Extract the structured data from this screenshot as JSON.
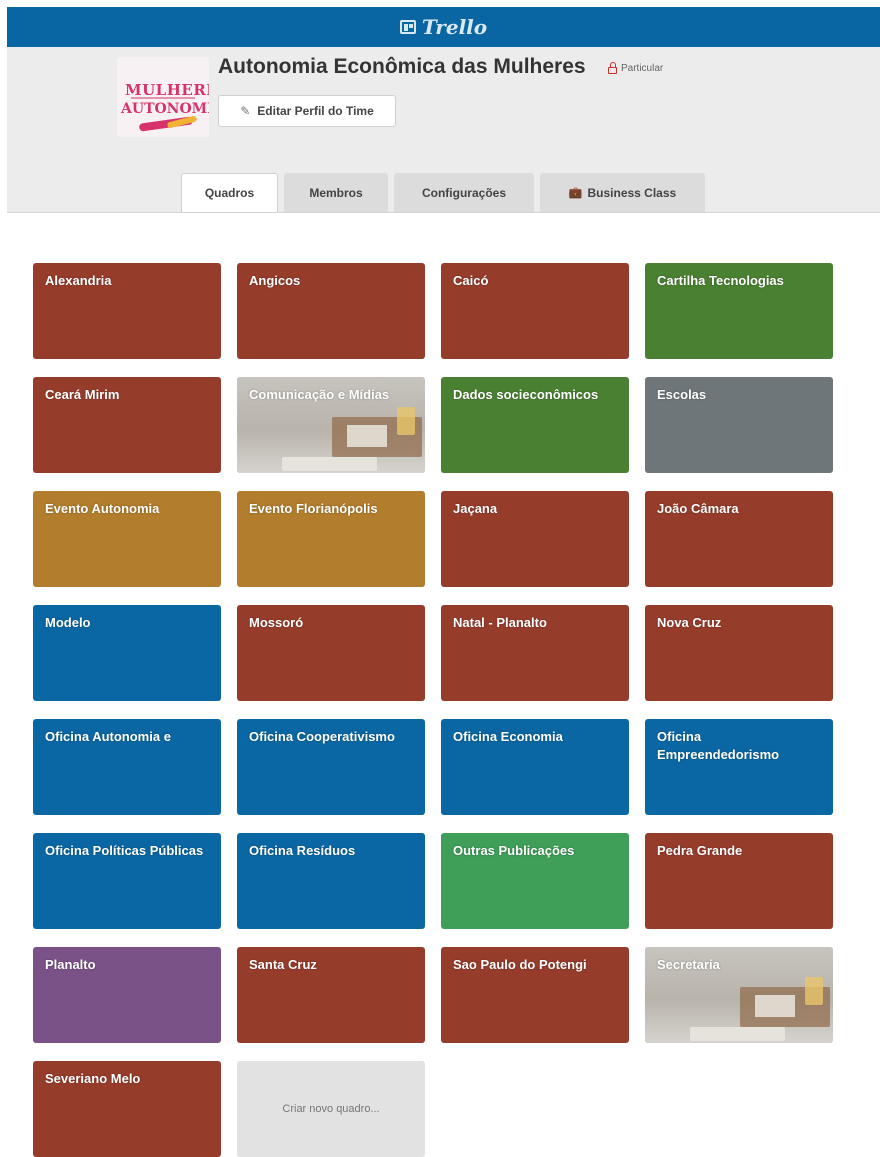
{
  "app": {
    "logo_text": "Trello"
  },
  "team": {
    "name": "Autonomia Econômica das Mulheres",
    "privacy": "Particular",
    "edit_label": "Editar Perfil do Time",
    "logo_text_top": "MULHERES",
    "logo_text_bottom": "AUTONOMIA"
  },
  "tabs": [
    {
      "label": "Quadros"
    },
    {
      "label": "Membros"
    },
    {
      "label": "Configurações"
    },
    {
      "label": "Business Class"
    }
  ],
  "colors": {
    "red": "#963c2b",
    "green": "#4a8032",
    "gray": "#6e7679",
    "orange": "#b27d2c",
    "blue": "#0b67a3",
    "light_green": "#3f9e58",
    "purple": "#7a5287"
  },
  "boards": [
    {
      "name": "Alexandria",
      "color": "#963c2b"
    },
    {
      "name": "Angicos",
      "color": "#963c2b"
    },
    {
      "name": "Caicó",
      "color": "#963c2b"
    },
    {
      "name": "Cartilha Tecnologias",
      "color": "#4a8032"
    },
    {
      "name": "Ceará Mirim",
      "color": "#963c2b"
    },
    {
      "name": "Comunicação e Mídias",
      "color": "photo"
    },
    {
      "name": "Dados socieconômicos",
      "color": "#4a8032"
    },
    {
      "name": "Escolas",
      "color": "#6e7679"
    },
    {
      "name": "Evento Autonomia",
      "color": "#b27d2c"
    },
    {
      "name": "Evento Florianópolis",
      "color": "#b27d2c"
    },
    {
      "name": "Jaçana",
      "color": "#963c2b"
    },
    {
      "name": "João Câmara",
      "color": "#963c2b"
    },
    {
      "name": "Modelo",
      "color": "#0b67a3"
    },
    {
      "name": "Mossoró",
      "color": "#963c2b"
    },
    {
      "name": "Natal - Planalto",
      "color": "#963c2b"
    },
    {
      "name": "Nova Cruz",
      "color": "#963c2b"
    },
    {
      "name": "Oficina Autonomia e",
      "color": "#0b67a3"
    },
    {
      "name": "Oficina Cooperativismo",
      "color": "#0b67a3"
    },
    {
      "name": "Oficina Economia",
      "color": "#0b67a3"
    },
    {
      "name": "Oficina Empreendedorismo",
      "color": "#0b67a3"
    },
    {
      "name": "Oficina Políticas Públicas",
      "color": "#0b67a3"
    },
    {
      "name": "Oficina Resíduos",
      "color": "#0b67a3"
    },
    {
      "name": "Outras Publicações",
      "color": "#3f9e58"
    },
    {
      "name": "Pedra Grande",
      "color": "#963c2b"
    },
    {
      "name": "Planalto",
      "color": "#7a5287"
    },
    {
      "name": "Santa Cruz",
      "color": "#963c2b"
    },
    {
      "name": "Sao Paulo do Potengi",
      "color": "#963c2b"
    },
    {
      "name": "Secretaria",
      "color": "photo"
    },
    {
      "name": "Severiano Melo",
      "color": "#963c2b"
    }
  ],
  "create_board_label": "Criar novo quadro..."
}
